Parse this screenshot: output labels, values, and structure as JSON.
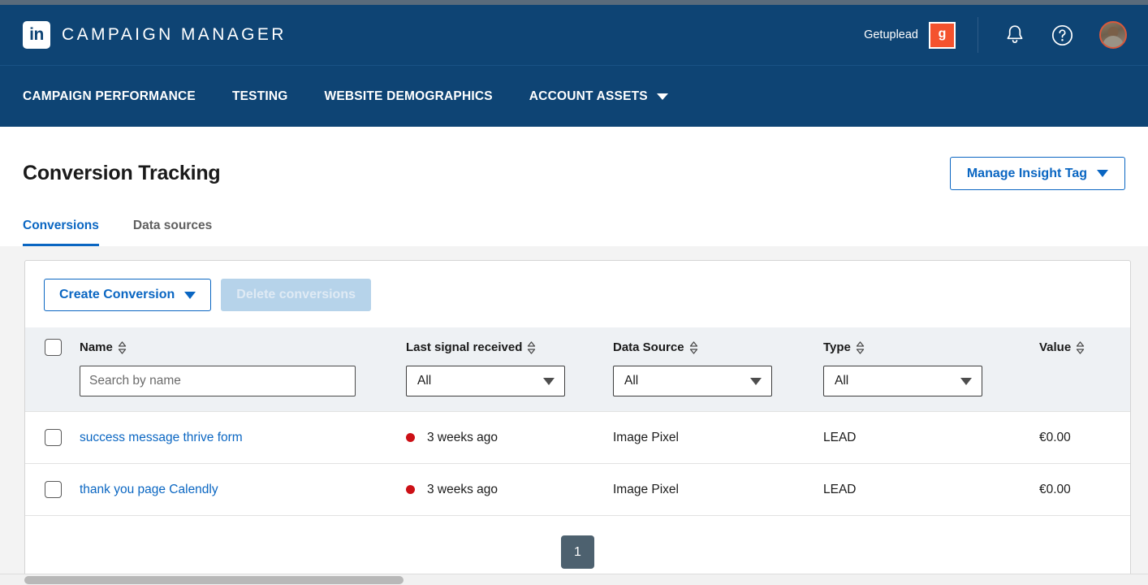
{
  "header": {
    "logo_icon": "linkedin-logo-icon",
    "brand": "CAMPAIGN MANAGER",
    "account_name": "Getuplead",
    "account_badge": "g",
    "notifications_icon": "bell-icon",
    "help_icon": "question-circle-icon",
    "avatar_icon": "user-avatar",
    "accent_blue": "#0e4474",
    "badge_orange": "#f4522e"
  },
  "nav": {
    "items": [
      {
        "label": "CAMPAIGN PERFORMANCE",
        "has_caret": false
      },
      {
        "label": "TESTING",
        "has_caret": false
      },
      {
        "label": "WEBSITE DEMOGRAPHICS",
        "has_caret": false
      },
      {
        "label": "ACCOUNT ASSETS",
        "has_caret": true
      }
    ]
  },
  "page": {
    "title": "Conversion Tracking",
    "manage_button": "Manage Insight Tag",
    "tabs": [
      {
        "label": "Conversions",
        "active": true
      },
      {
        "label": "Data sources",
        "active": false
      }
    ]
  },
  "toolbar": {
    "create_label": "Create Conversion",
    "delete_label": "Delete conversions",
    "delete_disabled": true
  },
  "table": {
    "columns": [
      {
        "label": "Name",
        "sortable": true
      },
      {
        "label": "Last signal received",
        "sortable": true
      },
      {
        "label": "Data Source",
        "sortable": true
      },
      {
        "label": "Type",
        "sortable": true
      },
      {
        "label": "Value",
        "sortable": true
      }
    ],
    "filters": {
      "name_placeholder": "Search by name",
      "last_signal": "All",
      "data_source": "All",
      "type": "All"
    },
    "rows": [
      {
        "name": "success message thrive form",
        "status_color": "#cc1016",
        "last_signal": "3 weeks ago",
        "data_source": "Image Pixel",
        "type": "LEAD",
        "value": "€0.00"
      },
      {
        "name": "thank you page Calendly",
        "status_color": "#cc1016",
        "last_signal": "3 weeks ago",
        "data_source": "Image Pixel",
        "type": "LEAD",
        "value": "€0.00"
      }
    ]
  },
  "pagination": {
    "current_page": "1"
  }
}
